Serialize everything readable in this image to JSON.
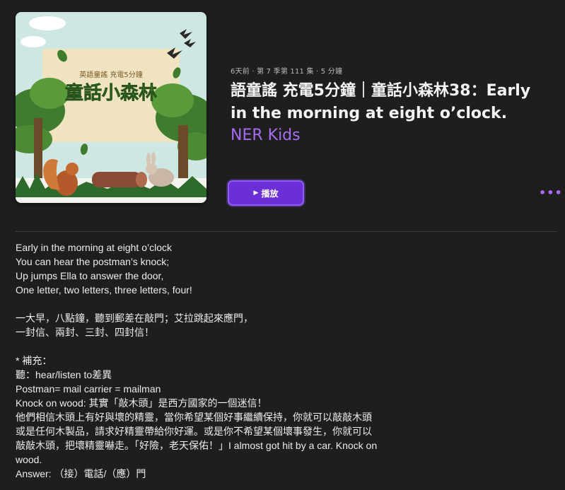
{
  "artwork": {
    "subtitle_text": "英語童謠 充電5分鐘",
    "title_text": "童話小森林",
    "name": "podcast-artwork"
  },
  "episode": {
    "eyebrow": "6天前 · 第 7 季第 111 集 · 5 分鐘",
    "title_line1": "語童謠 充電5分鐘｜童話小森林38：Early",
    "title_line2": "in the morning at eight o’clock.",
    "show_name": "NER Kids"
  },
  "actions": {
    "play_label": "播放",
    "play_icon": "▶",
    "more_icon": "•••"
  },
  "colors": {
    "background": "#1e1e1f",
    "accent": "#a66df0",
    "play_button": "#6b2fd6"
  },
  "notes": {
    "lines": [
      "Early in the morning at eight o’clock",
      "You can hear the postman’s knock;",
      "Up jumps Ella to answer the door,",
      "One letter, two letters, three letters, four!",
      "",
      "一大早，八點鐘，聽到郵差在敲門；艾拉跳起來應門，",
      "一封信、兩封、三封、四封信！",
      "",
      "* 補充：",
      "聽：hear/listen to差異",
      "Postman= mail carrier = mailman",
      "Knock on wood: 其實「敲木頭」是西方國家的一個迷信！",
      "他們相信木頭上有好與壞的精靈，當你希望某個好事繼續保持，你就可以敲敲木頭",
      "或是任何木製品，請求好精靈帶給你好運。或是你不希望某個壞事發生，你就可以",
      "敲敲木頭，把壞精靈嚇走。「好險，老天保佑！」I almost got hit by a car. Knock on",
      "wood.",
      "Answer: （接）電話/（應）門"
    ]
  }
}
